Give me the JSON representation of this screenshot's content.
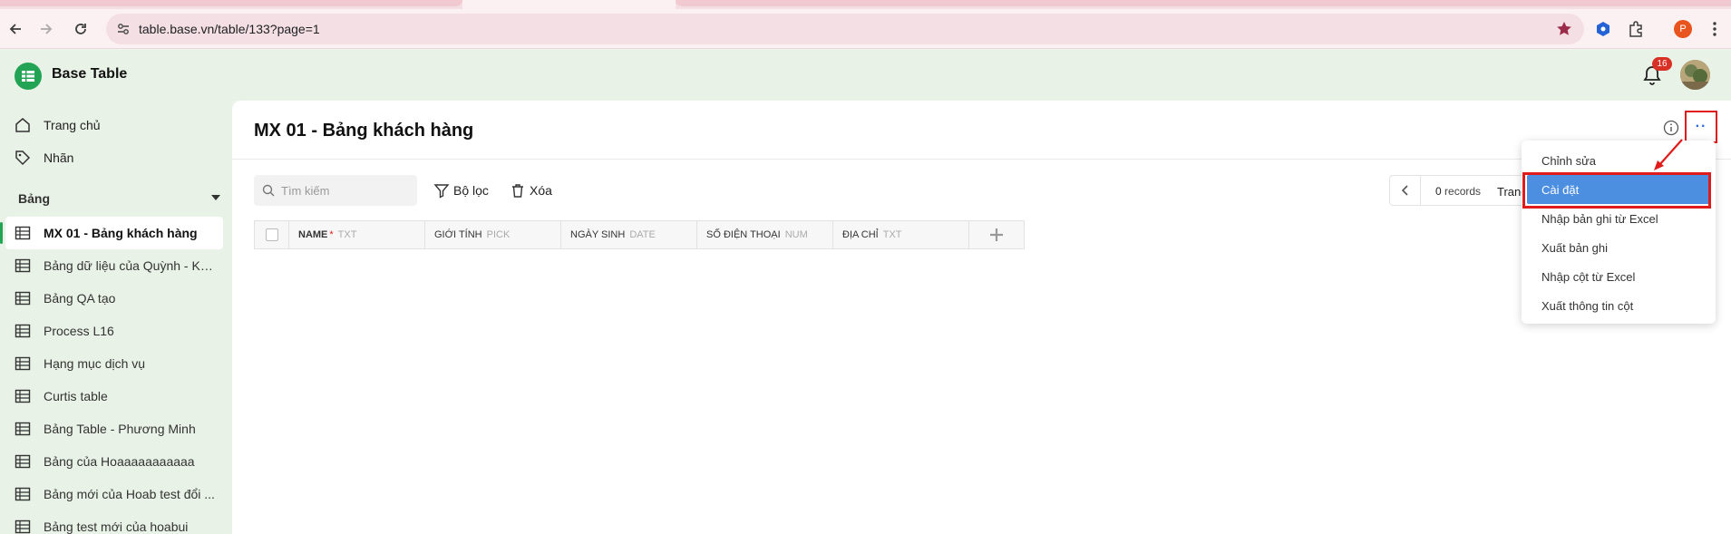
{
  "browser": {
    "url": "table.base.vn/table/133?page=1"
  },
  "app": {
    "name": "Base Table",
    "notification_count": "16"
  },
  "sidebar": {
    "links": [
      {
        "label": "Trang chủ",
        "icon": "home-icon"
      },
      {
        "label": "Nhãn",
        "icon": "tag-icon"
      }
    ],
    "section_title": "Bảng",
    "tables": [
      {
        "label": "MX 01 - Bảng khách hàng",
        "active": true
      },
      {
        "label": "Bảng dữ liệu của Quỳnh - KH..."
      },
      {
        "label": "Bảng QA tạo"
      },
      {
        "label": "Process L16"
      },
      {
        "label": "Hạng mục dịch vụ"
      },
      {
        "label": "Curtis table"
      },
      {
        "label": "Bảng Table - Phương Minh"
      },
      {
        "label": "Bảng của Hoaaaaaaaaaaa"
      },
      {
        "label": "Bảng mới của Hoab test đổi ..."
      },
      {
        "label": "Bảng test mới của hoabui"
      }
    ]
  },
  "main": {
    "title": "MX 01 - Bảng khách hàng",
    "search_placeholder": "Tìm kiếm",
    "filter_label": "Bộ lọc",
    "delete_label": "Xóa",
    "pager": {
      "count": "0",
      "records_label": "records",
      "page_label": "Trang"
    },
    "columns": [
      {
        "name": "NAME",
        "type": "TXT",
        "required": "*"
      },
      {
        "name": "GIỚI TÍNH",
        "type": "PICK"
      },
      {
        "name": "NGÀY SINH",
        "type": "DATE"
      },
      {
        "name": "SỐ ĐIỆN THOẠI",
        "type": "NUM"
      },
      {
        "name": "ĐỊA CHỈ",
        "type": "TXT"
      }
    ],
    "more_label": "··"
  },
  "menu": {
    "items": [
      {
        "label": "Chỉnh sửa"
      },
      {
        "label": "Cài đặt",
        "active": true
      },
      {
        "label": "Nhập bản ghi từ Excel"
      },
      {
        "label": "Xuất bản ghi"
      },
      {
        "label": "Nhập cột từ Excel"
      },
      {
        "label": "Xuất thông tin cột"
      }
    ]
  },
  "colors": {
    "brand": "#23a455",
    "menu_active": "#4c8fe0",
    "highlight": "#e01b1b"
  }
}
